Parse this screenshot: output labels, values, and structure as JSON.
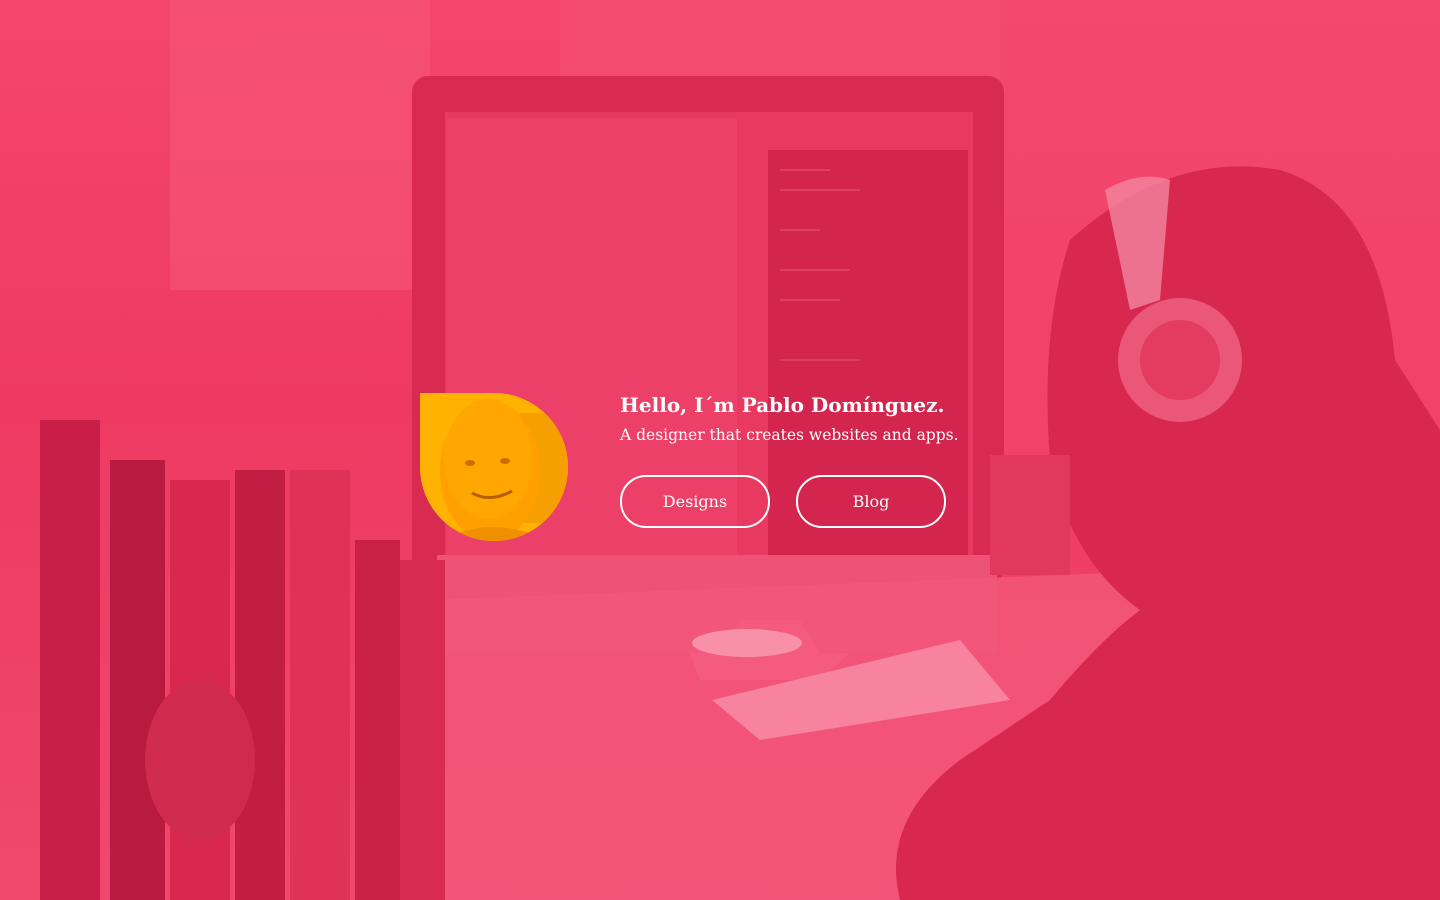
{
  "hero": {
    "title": "Hello, I´m Pablo Domínguez.",
    "subtitle": "A designer that creates websites and apps.",
    "avatar_alt": "Pablo Domínguez"
  },
  "nav": {
    "designs_label": "Designs",
    "blog_label": "Blog"
  },
  "colors": {
    "background": "#f0345e",
    "avatar": "#ffb300",
    "text": "#ffffff"
  }
}
